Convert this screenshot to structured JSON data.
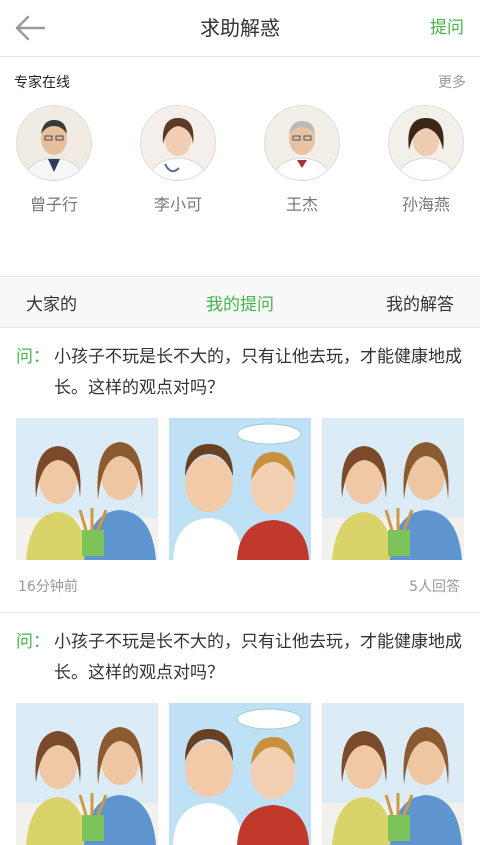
{
  "header": {
    "back_icon": "back-arrow-icon",
    "title": "求助解惑",
    "ask_label": "提问",
    "accent": "#46b449"
  },
  "experts": {
    "title": "专家在线",
    "more_label": "更多",
    "items": [
      {
        "name": "曾子行"
      },
      {
        "name": "李小可"
      },
      {
        "name": "王杰"
      },
      {
        "name": "孙海燕"
      }
    ]
  },
  "tabs": [
    {
      "label": "大家的",
      "active": false
    },
    {
      "label": "我的提问",
      "active": true
    },
    {
      "label": "我的解答",
      "active": false
    }
  ],
  "questions": [
    {
      "mark": "问：",
      "text": "小孩子不玩是长不大的，只有让他去玩，才能健康地成长。这样的观点对吗？",
      "time": "16分钟前",
      "answers": "5人回答"
    },
    {
      "mark": "问：",
      "text": "小孩子不玩是长不大的，只有让他去玩，才能健康地成长。这样的观点对吗？"
    }
  ]
}
